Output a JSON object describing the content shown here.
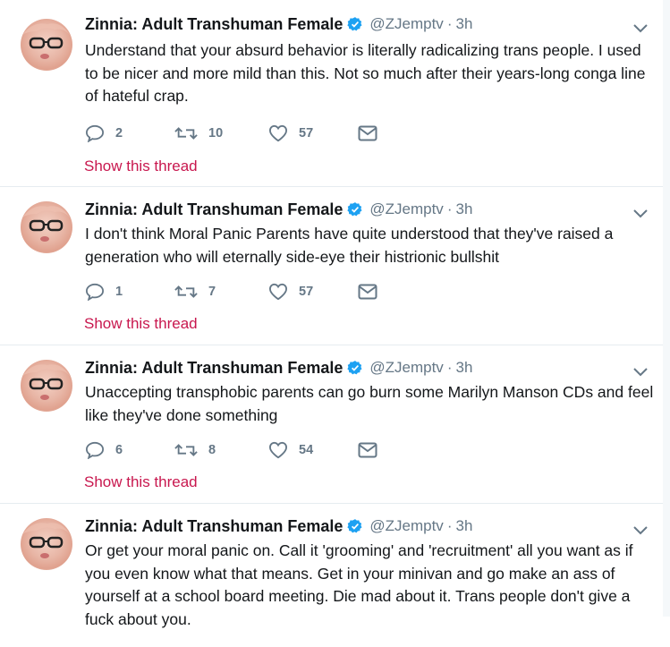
{
  "tweets": [
    {
      "display_name": "Zinnia: Adult Transhuman Female",
      "handle": "@ZJemptv",
      "separator": "·",
      "time": "3h",
      "text": "Understand that your absurd behavior is literally radicalizing trans people. I used to be nicer and more mild than this. Not so much after their years-long conga line of hateful crap.",
      "replies": "2",
      "retweets": "10",
      "likes": "57",
      "show_thread": "Show this thread"
    },
    {
      "display_name": "Zinnia: Adult Transhuman Female",
      "handle": "@ZJemptv",
      "separator": "·",
      "time": "3h",
      "text": "I don't think Moral Panic Parents have quite understood that they've raised a generation who will eternally side-eye their histrionic bullshit",
      "replies": "1",
      "retweets": "7",
      "likes": "57",
      "show_thread": "Show this thread"
    },
    {
      "display_name": "Zinnia: Adult Transhuman Female",
      "handle": "@ZJemptv",
      "separator": "·",
      "time": "3h",
      "text": "Unaccepting transphobic parents can go burn some Marilyn Manson CDs and feel like they've done something",
      "replies": "6",
      "retweets": "8",
      "likes": "54",
      "show_thread": "Show this thread"
    },
    {
      "display_name": "Zinnia: Adult Transhuman Female",
      "handle": "@ZJemptv",
      "separator": "·",
      "time": "3h",
      "text": "Or get your moral panic on. Call it 'grooming' and 'recruitment' all you want as if you even know what that means. Get in your minivan and go make an ass of yourself at a school board meeting. Die mad about it. Trans people don't give a fuck about you."
    }
  ],
  "icons": {
    "verified": "verified-badge-icon",
    "caret": "chevron-down-icon",
    "reply": "reply-icon",
    "retweet": "retweet-icon",
    "like": "heart-icon",
    "dm": "envelope-icon"
  },
  "colors": {
    "text": "#14171a",
    "secondary": "#657786",
    "verified": "#1da1f2",
    "thread_link": "#c8174e",
    "divider": "#e6ecf0"
  }
}
